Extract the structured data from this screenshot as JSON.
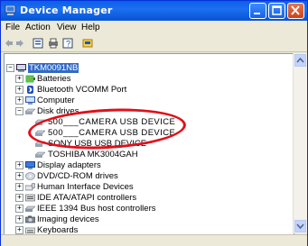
{
  "window": {
    "title": "Device Manager"
  },
  "menu": {
    "file": "File",
    "action": "Action",
    "view": "View",
    "help": "Help"
  },
  "tree": {
    "root": "TKM0091NB",
    "items": [
      {
        "label": "Batteries",
        "icon": "battery-icon"
      },
      {
        "label": "Bluetooth VCOMM Port",
        "icon": "bluetooth-icon"
      },
      {
        "label": "Computer",
        "icon": "computer-icon"
      },
      {
        "label": "Disk drives",
        "icon": "disk-icon"
      },
      {
        "label": "500___CAMERA USB DEVICE",
        "icon": "disk-icon"
      },
      {
        "label": "500___CAMERA USB DEVICE",
        "icon": "disk-icon"
      },
      {
        "label": "SONY USB USB DEVICE",
        "icon": "disk-icon"
      },
      {
        "label": "TOSHIBA MK3004GAH",
        "icon": "disk-icon"
      },
      {
        "label": "Display adapters",
        "icon": "display-icon"
      },
      {
        "label": "DVD/CD-ROM drives",
        "icon": "dvd-icon"
      },
      {
        "label": "Human Interface Devices",
        "icon": "hid-icon"
      },
      {
        "label": "IDE ATA/ATAPI controllers",
        "icon": "ide-icon"
      },
      {
        "label": "IEEE 1394 Bus host controllers",
        "icon": "ieee1394-icon"
      },
      {
        "label": "Imaging devices",
        "icon": "camera-icon"
      },
      {
        "label": "Keyboards",
        "icon": "keyboard-icon"
      }
    ]
  }
}
